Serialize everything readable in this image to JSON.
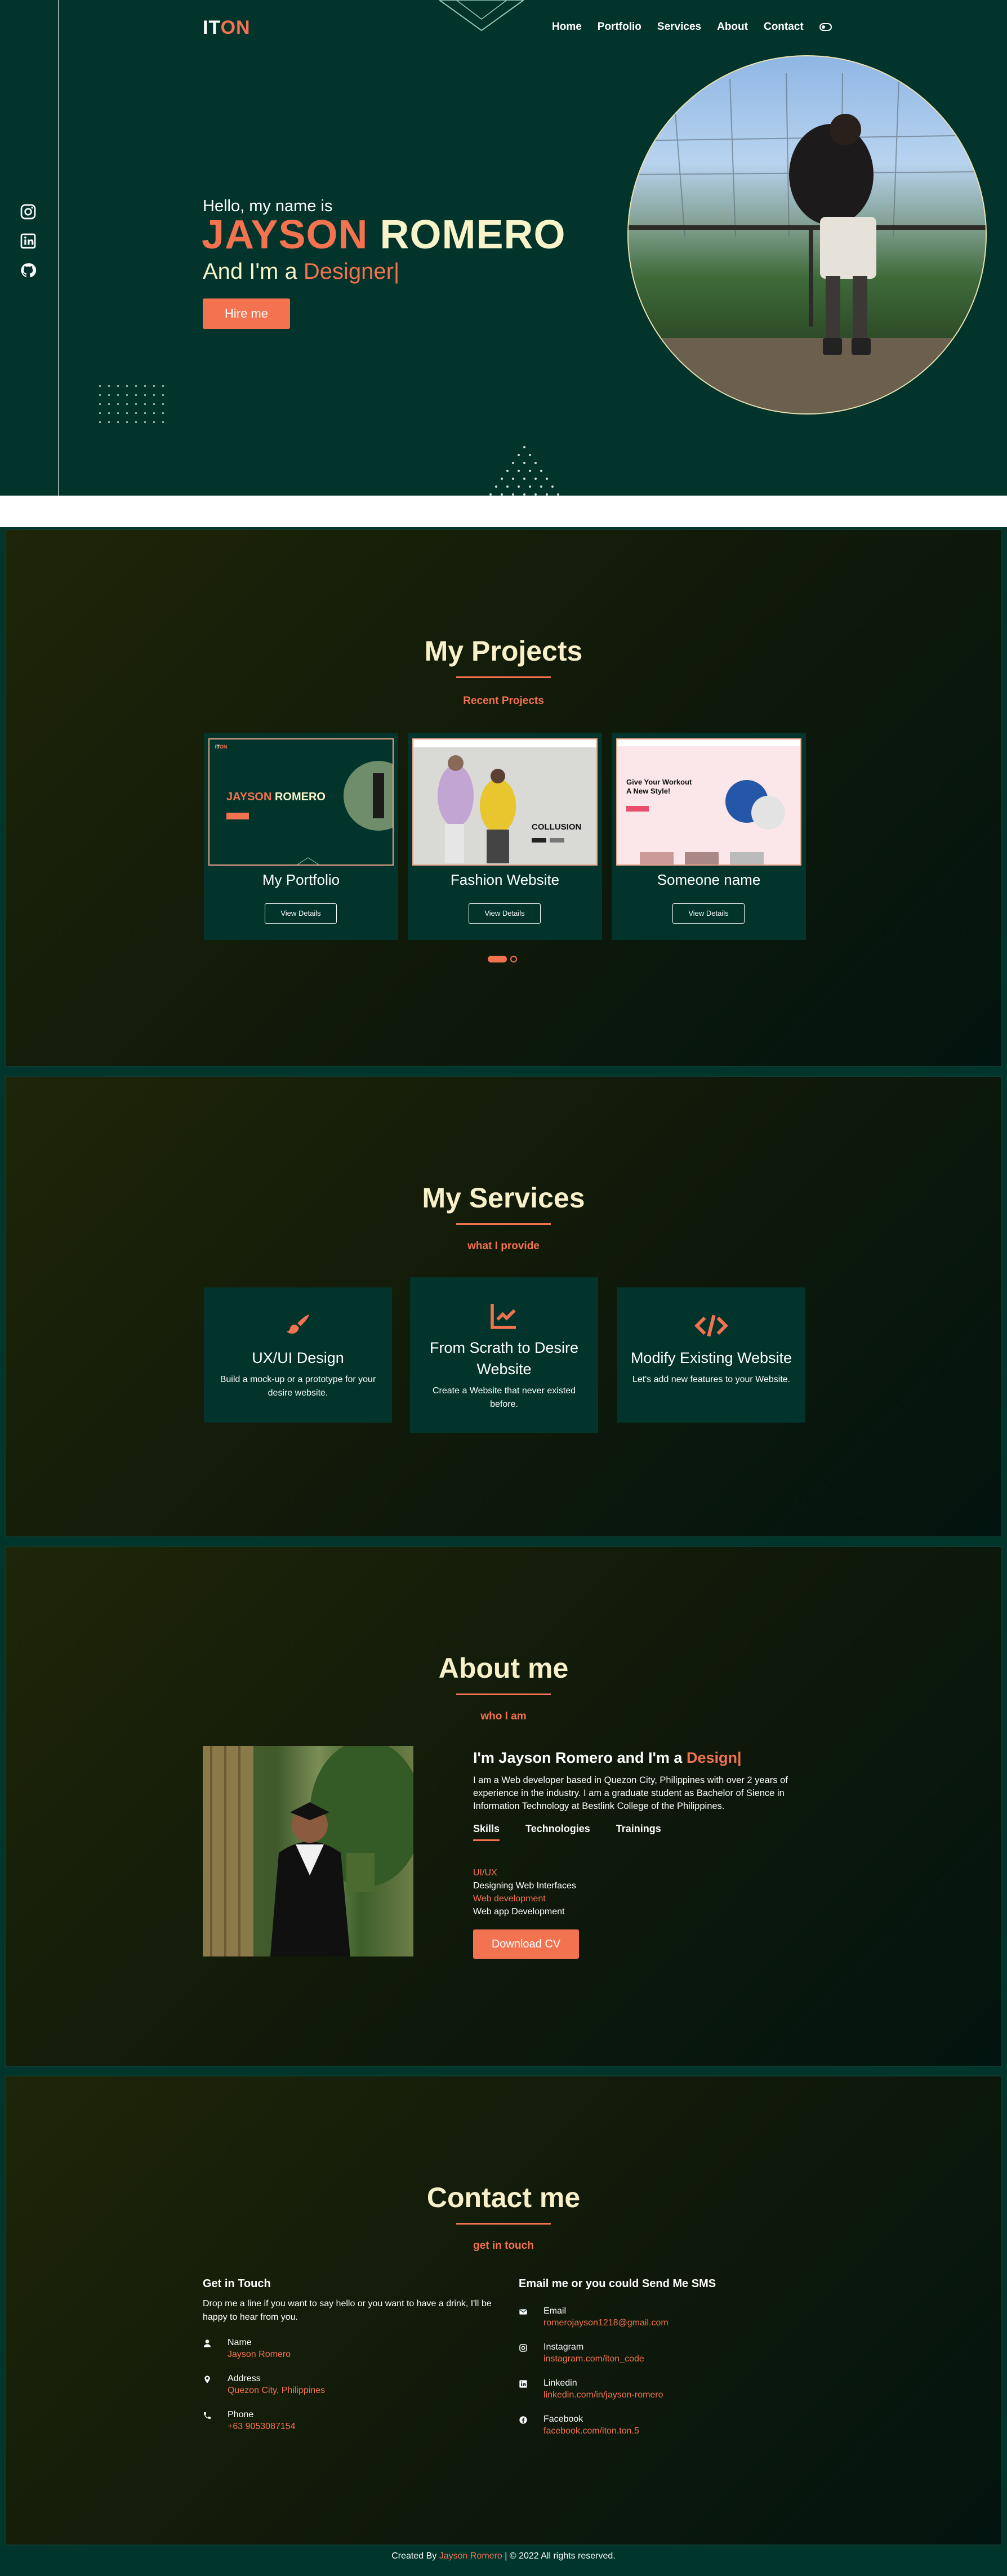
{
  "header": {
    "logo_a": "IT",
    "logo_b": "ON",
    "nav": [
      "Home",
      "Portfolio",
      "Services",
      "About",
      "Contact"
    ]
  },
  "socials": [
    "instagram-icon",
    "linkedin-icon",
    "github-icon"
  ],
  "hero": {
    "hello": "Hello, my name is",
    "first": "JAYSON",
    "last": "ROMERO",
    "role_prefix": "And I'm a",
    "role": "Designer|",
    "hire": "Hire me"
  },
  "projects": {
    "title": "My Projects",
    "subtitle": "Recent Projects",
    "cards": [
      {
        "title": "My Portfolio",
        "button": "View Details"
      },
      {
        "title": "Fashion Website",
        "button": "View Details"
      },
      {
        "title": "Someone name",
        "button": "View Details"
      }
    ],
    "mini": {
      "portfolio_name_a": "JAYSON",
      "portfolio_name_b": "ROMERO",
      "fashion_brand": "COLLUSION",
      "fitness_headline": "Give Your Workout A New Style!"
    },
    "page": 1,
    "pages": 2
  },
  "services": {
    "title": "My Services",
    "subtitle": "what I provide",
    "cards": [
      {
        "icon": "brush-icon",
        "title": "UX/UI Design",
        "desc": "Build a mock-up or a prototype for your desire website."
      },
      {
        "icon": "chart-line-icon",
        "title": "From Scrath to Desire Website",
        "desc": "Create a Website that never existed before."
      },
      {
        "icon": "code-icon",
        "title": "Modify Existing Website",
        "desc": "Let's add new features to your Website."
      }
    ]
  },
  "about": {
    "title": "About me",
    "subtitle": "who I am",
    "intro_prefix": "I'm Jayson Romero and I'm a",
    "intro_role": "Design|",
    "text": "I am a Web developer based in Quezon City, Philippines with over 2 years of experience in the industry. I am a graduate student as Bachelor of Sience in Information Technology at Bestlink College of the Philippines.",
    "tabs": [
      "Skills",
      "Technologies",
      "Trainings"
    ],
    "skills": [
      {
        "heading": "UI/UX",
        "detail": "Designing Web Interfaces"
      },
      {
        "heading": "Web development",
        "detail": "Web app Development"
      }
    ],
    "cv": "Download CV"
  },
  "contact": {
    "title": "Contact me",
    "subtitle": "get in touch",
    "left_title": "Get in Touch",
    "left_desc": "Drop me a line if you want to say hello or you want to have a drink, I'll be happy to hear from you.",
    "left": [
      {
        "icon": "user-icon",
        "label": "Name",
        "value": "Jayson Romero"
      },
      {
        "icon": "location-icon",
        "label": "Address",
        "value": "Quezon City, Philippines"
      },
      {
        "icon": "phone-icon",
        "label": "Phone",
        "value": "+63 9053087154"
      }
    ],
    "right_title": "Email me or you could Send Me SMS",
    "right": [
      {
        "icon": "mail-icon",
        "label": "Email",
        "value": "romerojayson1218@gmail.com"
      },
      {
        "icon": "instagram-icon",
        "label": "Instagram",
        "value": "instagram.com/iton_code"
      },
      {
        "icon": "linkedin-icon",
        "label": "Linkedin",
        "value": "linkedin.com/in/jayson-romero"
      },
      {
        "icon": "facebook-icon",
        "label": "Facebook",
        "value": "facebook.com/iton.ton.5"
      }
    ]
  },
  "footer": {
    "prefix": "Created By",
    "name": "Jayson Romero",
    "suffix": "| © 2022 All rights reserved."
  },
  "colors": {
    "accent": "#f37250",
    "bg": "#02342b",
    "cream": "#f7f0c8"
  }
}
